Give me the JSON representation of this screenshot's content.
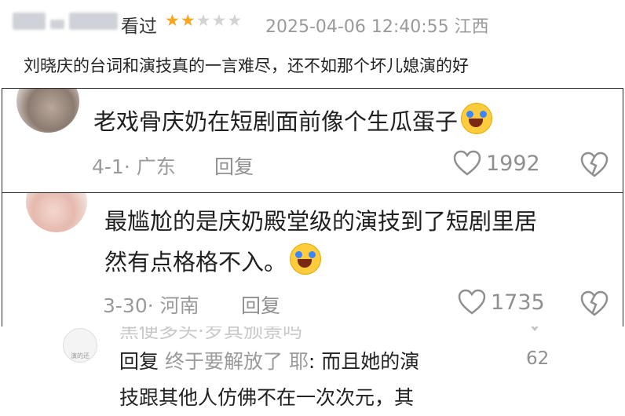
{
  "review": {
    "watched_label": "看过",
    "rating": 2,
    "max_rating": 5,
    "timestamp_location": "2025-04-06 12:40:55 江西",
    "text": "刘晓庆的台词和演技真的一言难尽，还不如那个坏儿媳演的好"
  },
  "comments": [
    {
      "text": "老戏骨庆奶在短剧面前像个生瓜蛋子",
      "emoji": "crying-laughing-emoji",
      "date_location": "4-1· 广东",
      "reply_label": "回复",
      "likes": "1992"
    },
    {
      "text_line1": "最尴尬的是庆奶殿堂级的演技到了短剧里居",
      "text_line2": "然有点格格不入。",
      "emoji": "crying-laughing-emoji",
      "date_location": "3-30· 河南",
      "reply_label": "回复",
      "likes": "1735"
    }
  ],
  "sub_reply": {
    "avatar_name": "演的还",
    "cut_text": "黑便多头·罗其颁景吗",
    "reply_label": "回复",
    "reply_user": "终于要解放了 耶",
    "line1": ": 而且她的演",
    "line2": "技跟其他人仿佛不在一次次元，其",
    "likes": "62"
  },
  "colors": {
    "star": "#f5a623",
    "muted": "#9a9a9a",
    "emoji_face": "#ffcc3d",
    "border": "#2a2a2a"
  }
}
